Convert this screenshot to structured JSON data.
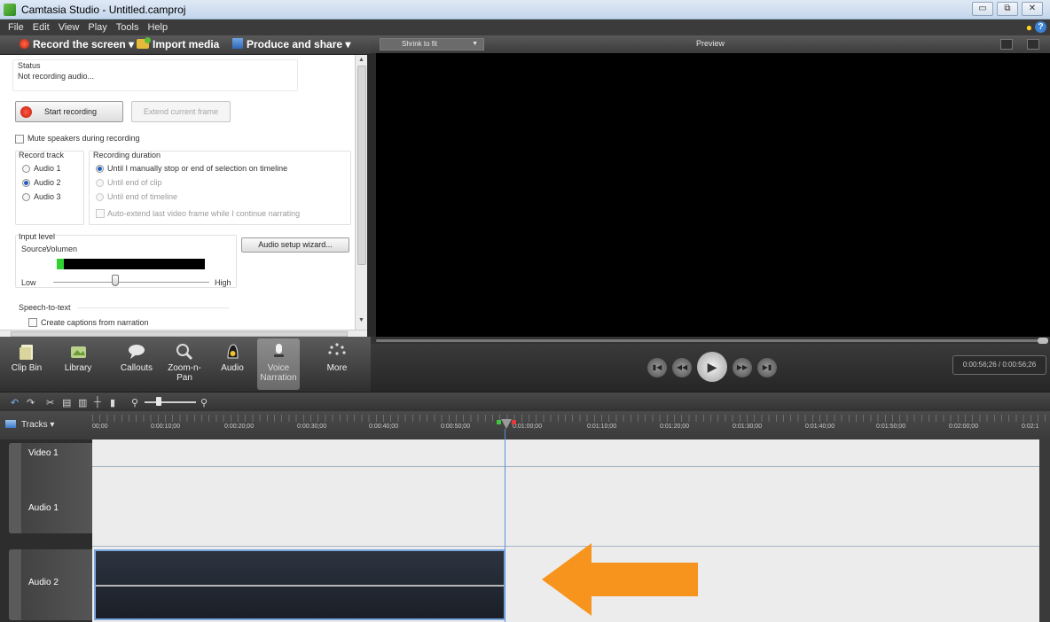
{
  "window": {
    "title": "Camtasia Studio - Untitled.camproj",
    "controls": [
      "▭",
      "⧉",
      "✕"
    ]
  },
  "menu": [
    "File",
    "Edit",
    "View",
    "Play",
    "Tools",
    "Help"
  ],
  "toolbar": {
    "record": "Record the screen ▾",
    "import": "Import media",
    "produce": "Produce and share ▾"
  },
  "recording": {
    "status_label": "Status",
    "status_text": "Not recording audio...",
    "start_button": "Start recording",
    "extend_button": "Extend current frame",
    "mute_label": "Mute speakers during recording",
    "record_track_label": "Record track",
    "tracks": [
      "Audio 1",
      "Audio 2",
      "Audio 3"
    ],
    "selected_track": "Audio 2",
    "duration_label": "Recording duration",
    "duration_options": [
      "Until I manually stop or end of selection on timeline",
      "Until end of clip",
      "Until end of timeline"
    ],
    "auto_extend": "Auto-extend last video frame while I continue narrating",
    "input_level_label": "Input level",
    "source_label": "Source:",
    "source_value": "Volumen",
    "audio_wizard_button": "Audio setup wizard...",
    "low_label": "Low",
    "high_label": "High",
    "input_level_fraction": 0.05,
    "volume_fraction": 0.4,
    "speech_label": "Speech-to-text",
    "captions_label": "Create captions from narration"
  },
  "tool_tabs": [
    {
      "label": "Clip Bin",
      "icon": "clip-bin-icon"
    },
    {
      "label": "Library",
      "icon": "library-icon"
    },
    {
      "label": "Callouts",
      "icon": "callouts-icon"
    },
    {
      "label": "Zoom-n-\nPan",
      "icon": "zoom-n-pan-icon"
    },
    {
      "label": "Audio",
      "icon": "audio-icon"
    },
    {
      "label": "Voice\nNarration",
      "icon": "voice-narration-icon"
    },
    {
      "label": "More",
      "icon": "more-icon"
    }
  ],
  "preview": {
    "shrink": "Shrink to fit",
    "title": "Preview",
    "timecode": "0:00:56;26 / 0:00:56;26"
  },
  "timeline": {
    "tracks_button": "Tracks",
    "ruler_ticks": [
      "00;00",
      "0:00:10;00",
      "0:00:20;00",
      "0:00:30;00",
      "0:00:40;00",
      "0:00:50;00",
      "0:01:00;00",
      "0:01:10;00",
      "0:01:20;00",
      "0:01:30;00",
      "0:01:40;00",
      "0:01:50;00",
      "0:02:00;00",
      "0:02:1"
    ],
    "track_names": [
      "Video 1",
      "Audio 1",
      "Audio 2"
    ]
  },
  "colors": {
    "arrow": "#f7941d",
    "clip_border": "#7aa7e0",
    "playhead": "#5b8fd8"
  }
}
